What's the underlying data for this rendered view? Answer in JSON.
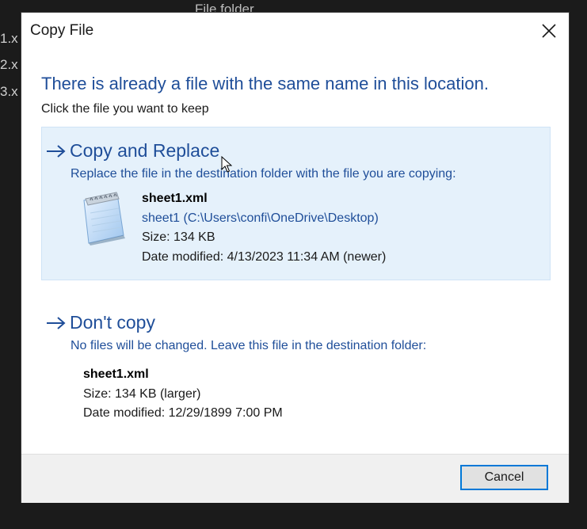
{
  "background": {
    "folder_label": "File folder",
    "file_fragments": [
      "1.x",
      "2.x",
      "3.x"
    ]
  },
  "dialog": {
    "title": "Copy File",
    "main_instruction": "There is already a file with the same name in this location.",
    "sub_instruction": "Click the file you want to keep",
    "replace_option": {
      "title": "Copy and Replace",
      "description": "Replace the file in the destination folder with the file you are copying:",
      "file": {
        "name": "sheet1.xml",
        "path": "sheet1 (C:\\Users\\confi\\OneDrive\\Desktop)",
        "size": "Size: 134 KB",
        "date": "Date modified: 4/13/2023 11:34 AM (newer)"
      }
    },
    "nocopy_option": {
      "title": "Don't copy",
      "description": "No files will be changed. Leave this file in the destination folder:",
      "file": {
        "name": "sheet1.xml",
        "size": "Size: 134 KB (larger)",
        "date": "Date modified: 12/29/1899 7:00 PM"
      }
    },
    "cancel_label": "Cancel"
  },
  "icons": {
    "close": "close-icon",
    "arrow": "arrow-right-icon",
    "file": "notepad-file-icon",
    "cursor": "mouse-pointer-icon"
  },
  "colors": {
    "accent": "#1f4e99",
    "highlight": "#e5f1fb",
    "focus_border": "#0078d7"
  }
}
